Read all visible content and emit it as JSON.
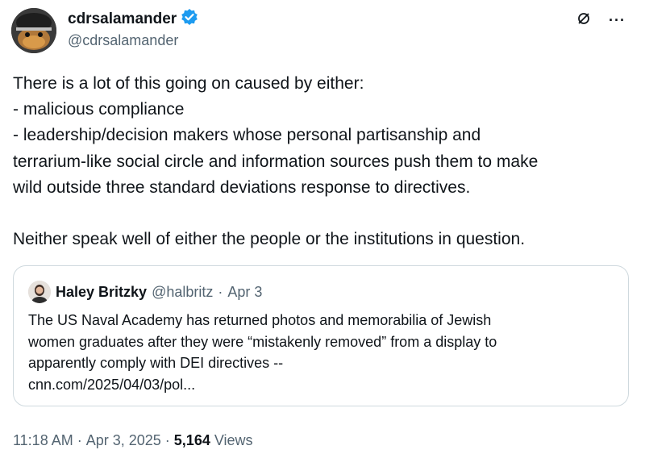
{
  "author": {
    "display_name": "cdrsalamander",
    "handle": "@cdrsalamander",
    "verified_color": "#1d9bf0"
  },
  "actions": {
    "grok_icon": "slash-circle-icon",
    "more_icon": "more-dots-icon",
    "more_label": "···"
  },
  "tweet": {
    "lines": [
      "There is a lot of this going on caused by either:",
      "- malicious compliance",
      "- leadership/decision makers whose personal partisanship and",
      "terrarium-like social circle and information sources push them to make",
      "wild outside three standard deviations response to directives.",
      "Neither speak well of either the people or the institutions in question."
    ]
  },
  "quote": {
    "display_name": "Haley Britzky",
    "handle": "@halbritz",
    "separator": "·",
    "date": "Apr 3",
    "lines": [
      "The US Naval Academy has returned photos and memorabilia of Jewish",
      "women graduates after they were “mistakenly removed” from a display to",
      "apparently comply with DEI directives --",
      "cnn.com/2025/04/03/pol..."
    ]
  },
  "footer": {
    "time": "11:18 AM",
    "sep1": "·",
    "date": "Apr 3, 2025",
    "sep2": "·",
    "views_count": "5,164",
    "views_label": "Views"
  },
  "colors": {
    "text": "#0f1419",
    "secondary": "#536471",
    "border": "#cfd9de",
    "accent": "#1d9bf0"
  }
}
